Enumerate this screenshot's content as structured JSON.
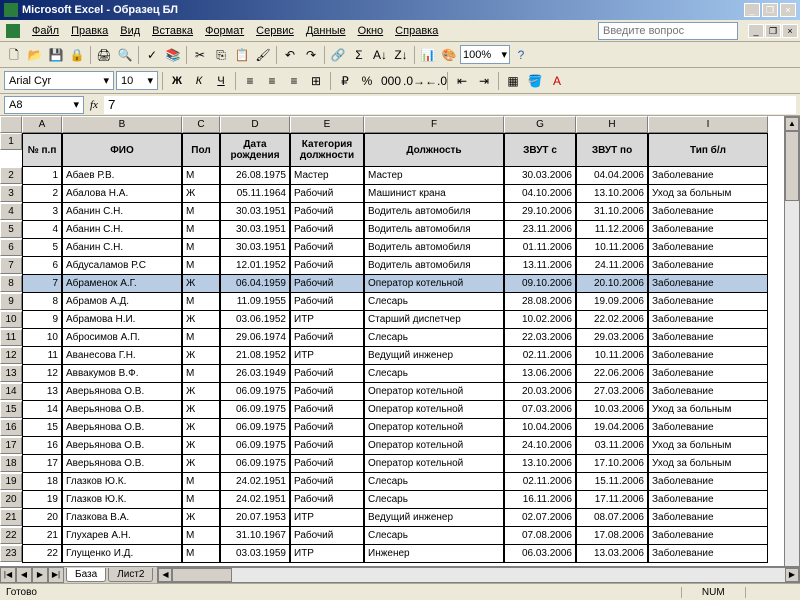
{
  "app": {
    "title": "Microsoft Excel - Образец БЛ"
  },
  "menu": [
    "Файл",
    "Правка",
    "Вид",
    "Вставка",
    "Формат",
    "Сервис",
    "Данные",
    "Окно",
    "Справка"
  ],
  "ask": {
    "placeholder": "Введите вопрос"
  },
  "font": {
    "name": "Arial Cyr",
    "size": "10"
  },
  "zoom": "100%",
  "namebox": "A8",
  "fx": "fx",
  "formula": "7",
  "col_letters": [
    "A",
    "B",
    "C",
    "D",
    "E",
    "F",
    "G",
    "H",
    "I"
  ],
  "headers": [
    "№ п.п",
    "ФИО",
    "Пол",
    "Дата рождения",
    "Категория должности",
    "Должность",
    "ЗВУТ с",
    "ЗВУТ по",
    "Тип б/л"
  ],
  "rows": [
    {
      "n": 1,
      "d": [
        "1",
        "Абаев Р.В.",
        "М",
        "26.08.1975",
        "Мастер",
        "Мастер",
        "30.03.2006",
        "04.04.2006",
        "Заболевание"
      ]
    },
    {
      "n": 2,
      "d": [
        "2",
        "Абалова Н.А.",
        "Ж",
        "05.11.1964",
        "Рабочий",
        "Машинист крана",
        "04.10.2006",
        "13.10.2006",
        "Уход за больным"
      ]
    },
    {
      "n": 3,
      "d": [
        "3",
        "Абанин С.Н.",
        "М",
        "30.03.1951",
        "Рабочий",
        "Водитель автомобиля",
        "29.10.2006",
        "31.10.2006",
        "Заболевание"
      ]
    },
    {
      "n": 4,
      "d": [
        "4",
        "Абанин С.Н.",
        "М",
        "30.03.1951",
        "Рабочий",
        "Водитель автомобиля",
        "23.11.2006",
        "11.12.2006",
        "Заболевание"
      ]
    },
    {
      "n": 5,
      "d": [
        "5",
        "Абанин С.Н.",
        "М",
        "30.03.1951",
        "Рабочий",
        "Водитель автомобиля",
        "01.11.2006",
        "10.11.2006",
        "Заболевание"
      ]
    },
    {
      "n": 6,
      "d": [
        "6",
        "Абдусаламов Р.С",
        "М",
        "12.01.1952",
        "Рабочий",
        "Водитель автомобиля",
        "13.11.2006",
        "24.11.2006",
        "Заболевание"
      ]
    },
    {
      "n": 7,
      "d": [
        "7",
        "Абраменок А.Г.",
        "Ж",
        "06.04.1959",
        "Рабочий",
        "Оператор котельной",
        "09.10.2006",
        "20.10.2006",
        "Заболевание"
      ]
    },
    {
      "n": 8,
      "d": [
        "8",
        "Абрамов А.Д.",
        "М",
        "11.09.1955",
        "Рабочий",
        "Слесарь",
        "28.08.2006",
        "19.09.2006",
        "Заболевание"
      ]
    },
    {
      "n": 9,
      "d": [
        "9",
        "Абрамова Н.И.",
        "Ж",
        "03.06.1952",
        "ИТР",
        "Старший диспетчер",
        "10.02.2006",
        "22.02.2006",
        "Заболевание"
      ]
    },
    {
      "n": 10,
      "d": [
        "10",
        "Абросимов А.П.",
        "М",
        "29.06.1974",
        "Рабочий",
        "Слесарь",
        "22.03.2006",
        "29.03.2006",
        "Заболевание"
      ]
    },
    {
      "n": 11,
      "d": [
        "11",
        "Аванесова Г.Н.",
        "Ж",
        "21.08.1952",
        "ИТР",
        "Ведущий инженер",
        "02.11.2006",
        "10.11.2006",
        "Заболевание"
      ]
    },
    {
      "n": 12,
      "d": [
        "12",
        "Аввакумов В.Ф.",
        "М",
        "26.03.1949",
        "Рабочий",
        "Слесарь",
        "13.06.2006",
        "22.06.2006",
        "Заболевание"
      ]
    },
    {
      "n": 13,
      "d": [
        "13",
        "Аверьянова О.В.",
        "Ж",
        "06.09.1975",
        "Рабочий",
        "Оператор котельной",
        "20.03.2006",
        "27.03.2006",
        "Заболевание"
      ]
    },
    {
      "n": 14,
      "d": [
        "14",
        "Аверьянова О.В.",
        "Ж",
        "06.09.1975",
        "Рабочий",
        "Оператор котельной",
        "07.03.2006",
        "10.03.2006",
        "Уход за больным"
      ]
    },
    {
      "n": 15,
      "d": [
        "15",
        "Аверьянова О.В.",
        "Ж",
        "06.09.1975",
        "Рабочий",
        "Оператор котельной",
        "10.04.2006",
        "19.04.2006",
        "Заболевание"
      ]
    },
    {
      "n": 16,
      "d": [
        "16",
        "Аверьянова О.В.",
        "Ж",
        "06.09.1975",
        "Рабочий",
        "Оператор котельной",
        "24.10.2006",
        "03.11.2006",
        "Уход за больным"
      ]
    },
    {
      "n": 17,
      "d": [
        "17",
        "Аверьянова О.В.",
        "Ж",
        "06.09.1975",
        "Рабочий",
        "Оператор котельной",
        "13.10.2006",
        "17.10.2006",
        "Уход за больным"
      ]
    },
    {
      "n": 18,
      "d": [
        "18",
        "Глазков Ю.К.",
        "М",
        "24.02.1951",
        "Рабочий",
        "Слесарь",
        "02.11.2006",
        "15.11.2006",
        "Заболевание"
      ]
    },
    {
      "n": 19,
      "d": [
        "19",
        "Глазков Ю.К.",
        "М",
        "24.02.1951",
        "Рабочий",
        "Слесарь",
        "16.11.2006",
        "17.11.2006",
        "Заболевание"
      ]
    },
    {
      "n": 20,
      "d": [
        "20",
        "Глазкова В.А.",
        "Ж",
        "20.07.1953",
        "ИТР",
        "Ведущий инженер",
        "02.07.2006",
        "08.07.2006",
        "Заболевание"
      ]
    },
    {
      "n": 21,
      "d": [
        "21",
        "Глухарев А.Н.",
        "М",
        "31.10.1967",
        "Рабочий",
        "Слесарь",
        "07.08.2006",
        "17.08.2006",
        "Заболевание"
      ]
    },
    {
      "n": 22,
      "d": [
        "22",
        "Глущенко И.Д.",
        "М",
        "03.03.1959",
        "ИТР",
        "Инженер",
        "06.03.2006",
        "13.03.2006",
        "Заболевание"
      ]
    }
  ],
  "tabs": {
    "active": "База",
    "inactive": "Лист2"
  },
  "status": {
    "ready": "Готово",
    "num": "NUM"
  },
  "selected_row": 8
}
